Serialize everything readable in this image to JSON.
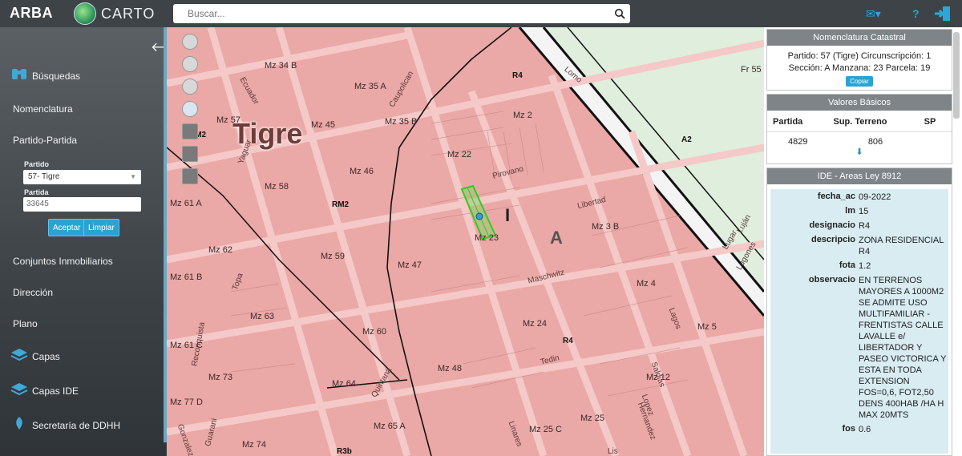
{
  "topbar": {
    "brand": "ARBA",
    "carto": "CARTO",
    "search_placeholder": "Buscar..."
  },
  "sidebar": {
    "items": [
      {
        "label": "Búsquedas"
      },
      {
        "label": "Nomenclatura"
      },
      {
        "label": "Partido-Partida"
      },
      {
        "label": "Conjuntos Inmobiliarios"
      },
      {
        "label": "Dirección"
      },
      {
        "label": "Plano"
      },
      {
        "label": "Capas"
      },
      {
        "label": "Capas IDE"
      },
      {
        "label": "Secretaría de DDHH"
      }
    ],
    "form": {
      "partido_label": "Partido",
      "partido_value": "57- Tigre",
      "partida_label": "Partida",
      "partida_value": "33645",
      "accept": "Aceptar",
      "clear": "Limpiar"
    }
  },
  "map": {
    "city": "Tigre",
    "labels": [
      "Mz 34 B",
      "Mz 35 A",
      "Mz 35 B",
      "Mz 57",
      "Mz 45",
      "Mz 2",
      "Mz 22",
      "Mz 46",
      "Mz 58",
      "Mz 61 A",
      "Mz 62",
      "Mz 59",
      "Mz 47",
      "Mz 3 B",
      "Mz 23",
      "Mz 61 B",
      "Mz 4",
      "Mz 63",
      "Mz 60",
      "Mz 24",
      "Mz 5",
      "Mz 61 C",
      "Mz 73",
      "Mz 64",
      "Mz 48",
      "Mz 12",
      "Mz 77 D",
      "Mz 65 A",
      "Mz 25",
      "Mz 25 C",
      "Mz 74",
      "Fr 55"
    ],
    "zones": [
      "R4",
      "RM2",
      "RM2",
      "R4",
      "A2",
      "R3b"
    ],
    "sections": [
      "I",
      "A"
    ],
    "streets": [
      "Ecuador",
      "Caupolican",
      "Pirovano",
      "Libertad",
      "Maschwitz",
      "Tedin",
      "Reconquista",
      "Guarani",
      "Gonzalez",
      "Quintana",
      "Lagos",
      "Saldias",
      "Lugar",
      "Lomo",
      "Lugones",
      "Linares",
      "Yaguar",
      "Topa",
      "Hernandez",
      "Lopez",
      "Luján",
      "Lis"
    ]
  },
  "panel": {
    "nomen_title": "Nomenclatura Catastral",
    "nomen_text": "Partido: 57 (Tigre) Circunscripción: 1 Sección: A Manzana: 23 Parcela: 19",
    "copy": "Copiar",
    "vb_title": "Valores Básicos",
    "vb_headers": [
      "Partida",
      "Sup. Terreno",
      "SP"
    ],
    "vb_values": [
      "4829",
      "806",
      ""
    ],
    "ide_title": "IDE - Areas Ley 8912",
    "ide_rows": [
      {
        "k": "fecha_ac",
        "v": "09-2022"
      },
      {
        "k": "lm",
        "v": "15"
      },
      {
        "k": "designacio",
        "v": "R4"
      },
      {
        "k": "descripcio",
        "v": "ZONA RESIDENCIAL R4"
      },
      {
        "k": "fota",
        "v": "1.2"
      },
      {
        "k": "observacio",
        "v": "EN TERRENOS MAYORES A 1000M2 SE ADMITE USO MULTIFAMILIAR - FRENTISTAS CALLE LAVALLE e/ LIBERTADOR Y PASEO VICTORICA Y ESTA EN TODA EXTENSION FOS=0,6, FOT2,50 DENS 400HAB /HA H MAX 20MTS"
      },
      {
        "k": "fos",
        "v": "0.6"
      }
    ]
  },
  "colors": {
    "accent": "#2aa3d3",
    "map_fill": "#eaa8a6",
    "topbar": "#3e4347"
  }
}
